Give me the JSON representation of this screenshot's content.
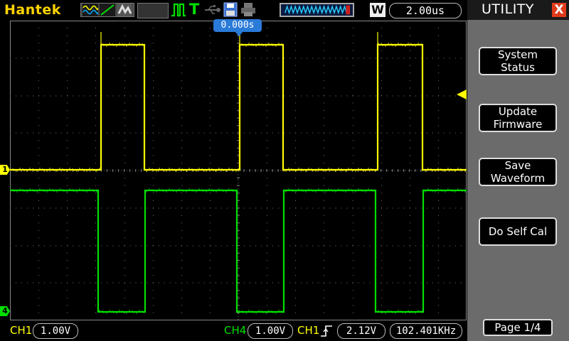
{
  "topbar": {
    "brand": "Hantek",
    "trigger_type_letter": "T",
    "waveform_letter": "W",
    "timebase": "2.00us",
    "trigger_position": "0.000s"
  },
  "icons": {
    "mode_icons": [
      "wave-mode-icon",
      "line-mode-icon",
      "persistence-mode-icon"
    ],
    "run_icon": "run-pulse-icon",
    "usb_icon": "usb-icon",
    "save_icon": "floppy-save-icon",
    "print_icon": "printer-icon"
  },
  "channels": {
    "ch1_marker": "1",
    "ch4_marker": "4"
  },
  "bottombar": {
    "ch1_label": "CH1",
    "ch1_scale": "1.00V",
    "ch4_label": "CH4",
    "ch4_scale": "1.00V",
    "trigger_source": "CH1",
    "trigger_level": "2.12V",
    "frequency": "102.401KHz"
  },
  "sidebar": {
    "title": "UTILITY",
    "close": "X",
    "buttons": [
      "System\nStatus",
      "Update\nFirmware",
      "Save\nWaveform",
      "Do Self Cal"
    ],
    "page": "Page 1/4"
  },
  "colors": {
    "ch1": "#ffff00",
    "ch4": "#00e000",
    "brand": "#ffd400",
    "trigger_marker": "#2a7ad8",
    "close": "#e03a1a"
  }
}
